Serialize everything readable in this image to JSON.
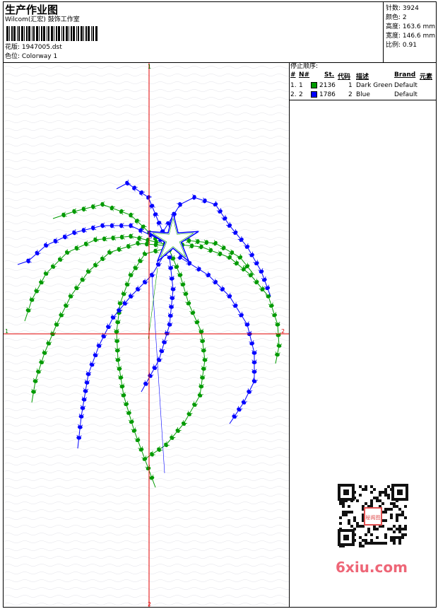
{
  "header": {
    "title": "生产作业图",
    "software": "Wilcom(汇宏) 鼓饰工作室",
    "design_label": "花版: 1947005.dst",
    "colorway_label": "色位: Colorway 1"
  },
  "stats": {
    "stitches": "针数: 3924",
    "colors": "颜色: 2",
    "height": "高度: 163.6 mm",
    "width": "宽度: 146.6 mm",
    "scale": "比例: 0.91"
  },
  "stop_sequence": {
    "title": "停止顺序:",
    "headers": [
      "#",
      "N#",
      "St.",
      "代码",
      "描述",
      "Brand",
      "元素"
    ],
    "rows": [
      {
        "index": "1.",
        "needle": "1",
        "color": "#009a00",
        "stitches": "2136",
        "code": "1",
        "description": "Dark Green",
        "brand": "Default"
      },
      {
        "index": "2.",
        "needle": "2",
        "color": "#0000ff",
        "stitches": "1786",
        "code": "2",
        "description": "Blue",
        "brand": "Default"
      }
    ]
  },
  "axes": {
    "top_marker": "1",
    "bottom_marker": "2",
    "left_marker": "1",
    "right_marker": "2"
  },
  "watermark": {
    "text": "6xiu.com",
    "seal_text": "秘阁图"
  },
  "colors": {
    "green": "#009a00",
    "blue": "#0000ff",
    "axis": "#e00000",
    "grid": "#cfcfd8"
  }
}
